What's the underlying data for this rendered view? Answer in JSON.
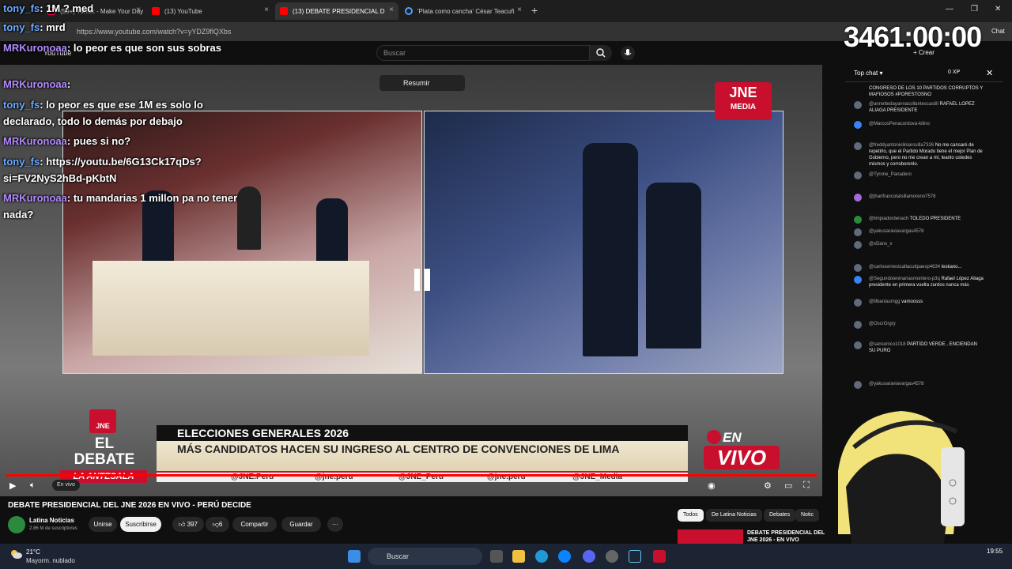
{
  "browser": {
    "tabs": [
      {
        "label": "(59+) TikTok - Make Your Day"
      },
      {
        "label": "(13) YouTube"
      },
      {
        "label": "(13) DEBATE PRESIDENCIAL D"
      },
      {
        "label": "'Plata como cancha' César Teacuñ"
      }
    ],
    "url": "https://www.youtube.com/watch?v=yYDZ9flQXbs",
    "chat_label": "Chat"
  },
  "youtube": {
    "logo": "YouTube",
    "search_placeholder": "Buscar",
    "create_label": "+ Crear",
    "video": {
      "resumir_label": "Resumir",
      "jne_big": "JNE",
      "jne_small": "MEDIA",
      "badge_text": "JNE",
      "el_debate": "EL DEBATE",
      "antesala": "LA ANTESALA",
      "headline_top": "ELECCIONES GENERALES 2026",
      "headline_body": "MÁS CANDIDATOS HACEN SU INGRESO AL CENTRO DE CONVENCIONES DE LIMA",
      "social": [
        "@JNE.Peru",
        "@jne.peru",
        "@JNE_Peru",
        "@jne.peru",
        "@JNE_Media"
      ],
      "en": "EN",
      "vivo": "VIVO",
      "live_tag": "En vivo"
    },
    "title": "DEBATE PRESIDENCIAL DEL JNE 2026 EN VIVO - PERÚ DECIDE",
    "channel": {
      "name": "Latina Noticias",
      "subscribers": "2.86 M de suscriptores",
      "unirse": "Unirse",
      "suscribirse": "Suscribirse",
      "likes": "397",
      "dislikes": "6",
      "compartir": "Compartir",
      "guardar": "Guardar"
    },
    "chips": [
      "Todos",
      "De Latina Noticias",
      "Debates",
      "Notic"
    ],
    "rec_title": "DEBATE PRESIDENCIAL DEL JNE 2026 - EN VIVO"
  },
  "chat": {
    "title": "Top chat",
    "xp": "0 XP",
    "messages": [
      {
        "author": "",
        "text": "CONGRESO DE LOS 10 PARTIDOS CORRUPTOS Y MAFIOSOS #PORESTOSNO"
      },
      {
        "author": "@annettedayannacollantescastill",
        "text": "RAFAEL LOPEZ ALIAGA PRESIDENTE"
      },
      {
        "author": "@MarcosPenacordova-kilino",
        "text": ""
      },
      {
        "author": "@freddyantonioliniarosilla7326",
        "text": "No me cansaré de repetirlo, que el Partido Morado tiene el mejor Plan de Gobierno, pero no me crean a mí, leanlo ustedes mismos y corroborenlo."
      },
      {
        "author": "@Tyrone_Panadero",
        "text": ""
      },
      {
        "author": "@jhanfrancotalsillamoreno7578",
        "text": ""
      },
      {
        "author": "@limpiadordenach",
        "text": "TOLEDO PRESIDENTE"
      },
      {
        "author": "@yakusaraviavargas4578",
        "text": ""
      },
      {
        "author": "@xDanx_x",
        "text": ""
      },
      {
        "author": "@carlosernestcallacutipaesp4634",
        "text": "leskano..."
      },
      {
        "author": "@Segundoleninariasmontero-p3q",
        "text": "Rafael López Aliaga presidente en primera vuelta zurdos nunca más"
      },
      {
        "author": "@lilbaniasmgg",
        "text": "vamoosss"
      },
      {
        "author": "@OscrGrgry",
        "text": ""
      },
      {
        "author": "@sansonico1018",
        "text": "PARTIDO VERDE , ENCIENDAN SU PURO"
      },
      {
        "author": "@yakusaraviavargas4578",
        "text": ""
      }
    ]
  },
  "stream_overlay": {
    "timer": "3461:00:00",
    "lines": [
      {
        "user": "tony_fs",
        "text": "1M ? med"
      },
      {
        "user": "tony_fs",
        "text": "mrd"
      },
      {
        "user": "MRKuronoaa",
        "text": "lo peor es que son sus sobras"
      },
      {
        "user": "MRKuronoaa",
        "text": ""
      },
      {
        "user": "tony_fs",
        "text": "lo peor es que ese 1M es solo lo declarado, todo lo demás por debajo"
      },
      {
        "user": "MRKuronoaa",
        "text": "pues si no?"
      },
      {
        "user": "tony_fs",
        "text": "https://youtu.be/6G13Ck17qDs?si=FV2NyS2hBd-pKbtN"
      },
      {
        "user": "MRKuronoaa",
        "text": "tu mandarias 1 millon pa no tener nada?"
      }
    ]
  },
  "taskbar": {
    "temp": "21°C",
    "weather": "Mayorm. nublado",
    "search": "Buscar",
    "time": "19:55"
  }
}
